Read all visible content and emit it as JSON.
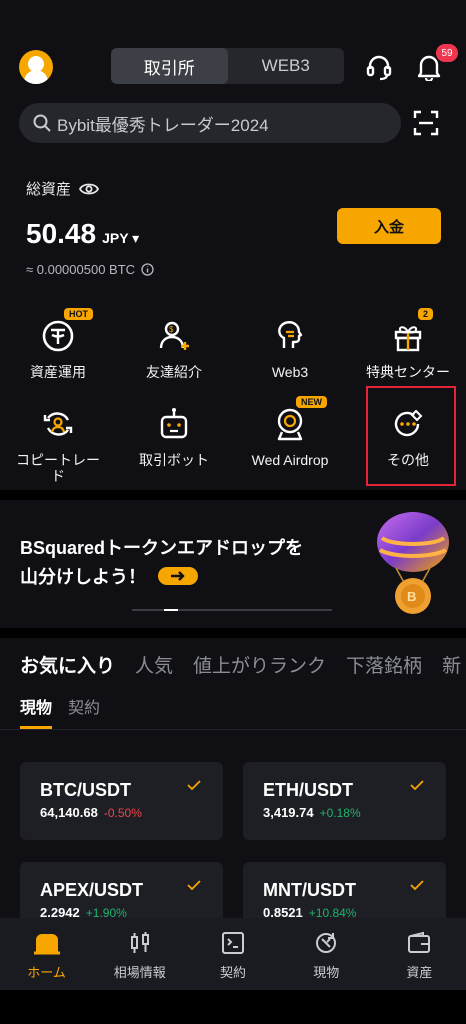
{
  "header": {
    "segment_tabs": [
      "取引所",
      "WEB3"
    ],
    "notification_count": "59"
  },
  "search": {
    "placeholder": "Bybit最優秀トレーダー2024"
  },
  "assets": {
    "title": "総資産",
    "balance": "50.48",
    "currency": "JPY",
    "btc_equivalent": "≈ 0.00000500 BTC",
    "deposit_label": "入金"
  },
  "shortcuts": [
    {
      "label": "資産運用",
      "tag": "HOT",
      "icon": "tether-icon"
    },
    {
      "label": "友達紹介",
      "tag": "",
      "icon": "referral-icon"
    },
    {
      "label": "Web3",
      "tag": "",
      "icon": "web3-icon"
    },
    {
      "label": "特典センター",
      "tag": "2",
      "icon": "gift-icon"
    },
    {
      "label": "コピートレード",
      "tag": "",
      "icon": "copy-trade-icon"
    },
    {
      "label": "取引ボット",
      "tag": "",
      "icon": "bot-icon"
    },
    {
      "label": "Wed Airdrop",
      "tag": "NEW",
      "icon": "airdrop-icon"
    },
    {
      "label": "その他",
      "tag": "",
      "icon": "more-icon"
    }
  ],
  "banner": {
    "line1": "BSquaredトークンエアドロップを",
    "line2": "山分けしよう！"
  },
  "market": {
    "tabs": [
      "お気に入り",
      "人気",
      "値上がりランク",
      "下落銘柄",
      "新"
    ],
    "subtabs": [
      "現物",
      "契約"
    ],
    "cards": [
      {
        "pair": "BTC/USDT",
        "price": "64,140.68",
        "change": "-0.50%"
      },
      {
        "pair": "ETH/USDT",
        "price": "3,419.74",
        "change": "+0.18%"
      },
      {
        "pair": "APEX/USDT",
        "price": "2.2942",
        "change": "+1.90%"
      },
      {
        "pair": "MNT/USDT",
        "price": "0.8521",
        "change": "+10.84%"
      }
    ]
  },
  "bottom_nav": [
    "ホーム",
    "相場情報",
    "契約",
    "現物",
    "資産"
  ],
  "colors": {
    "accent": "#f7a600",
    "up": "#20b26c",
    "down": "#ef454a",
    "highlight": "#e5243b"
  }
}
